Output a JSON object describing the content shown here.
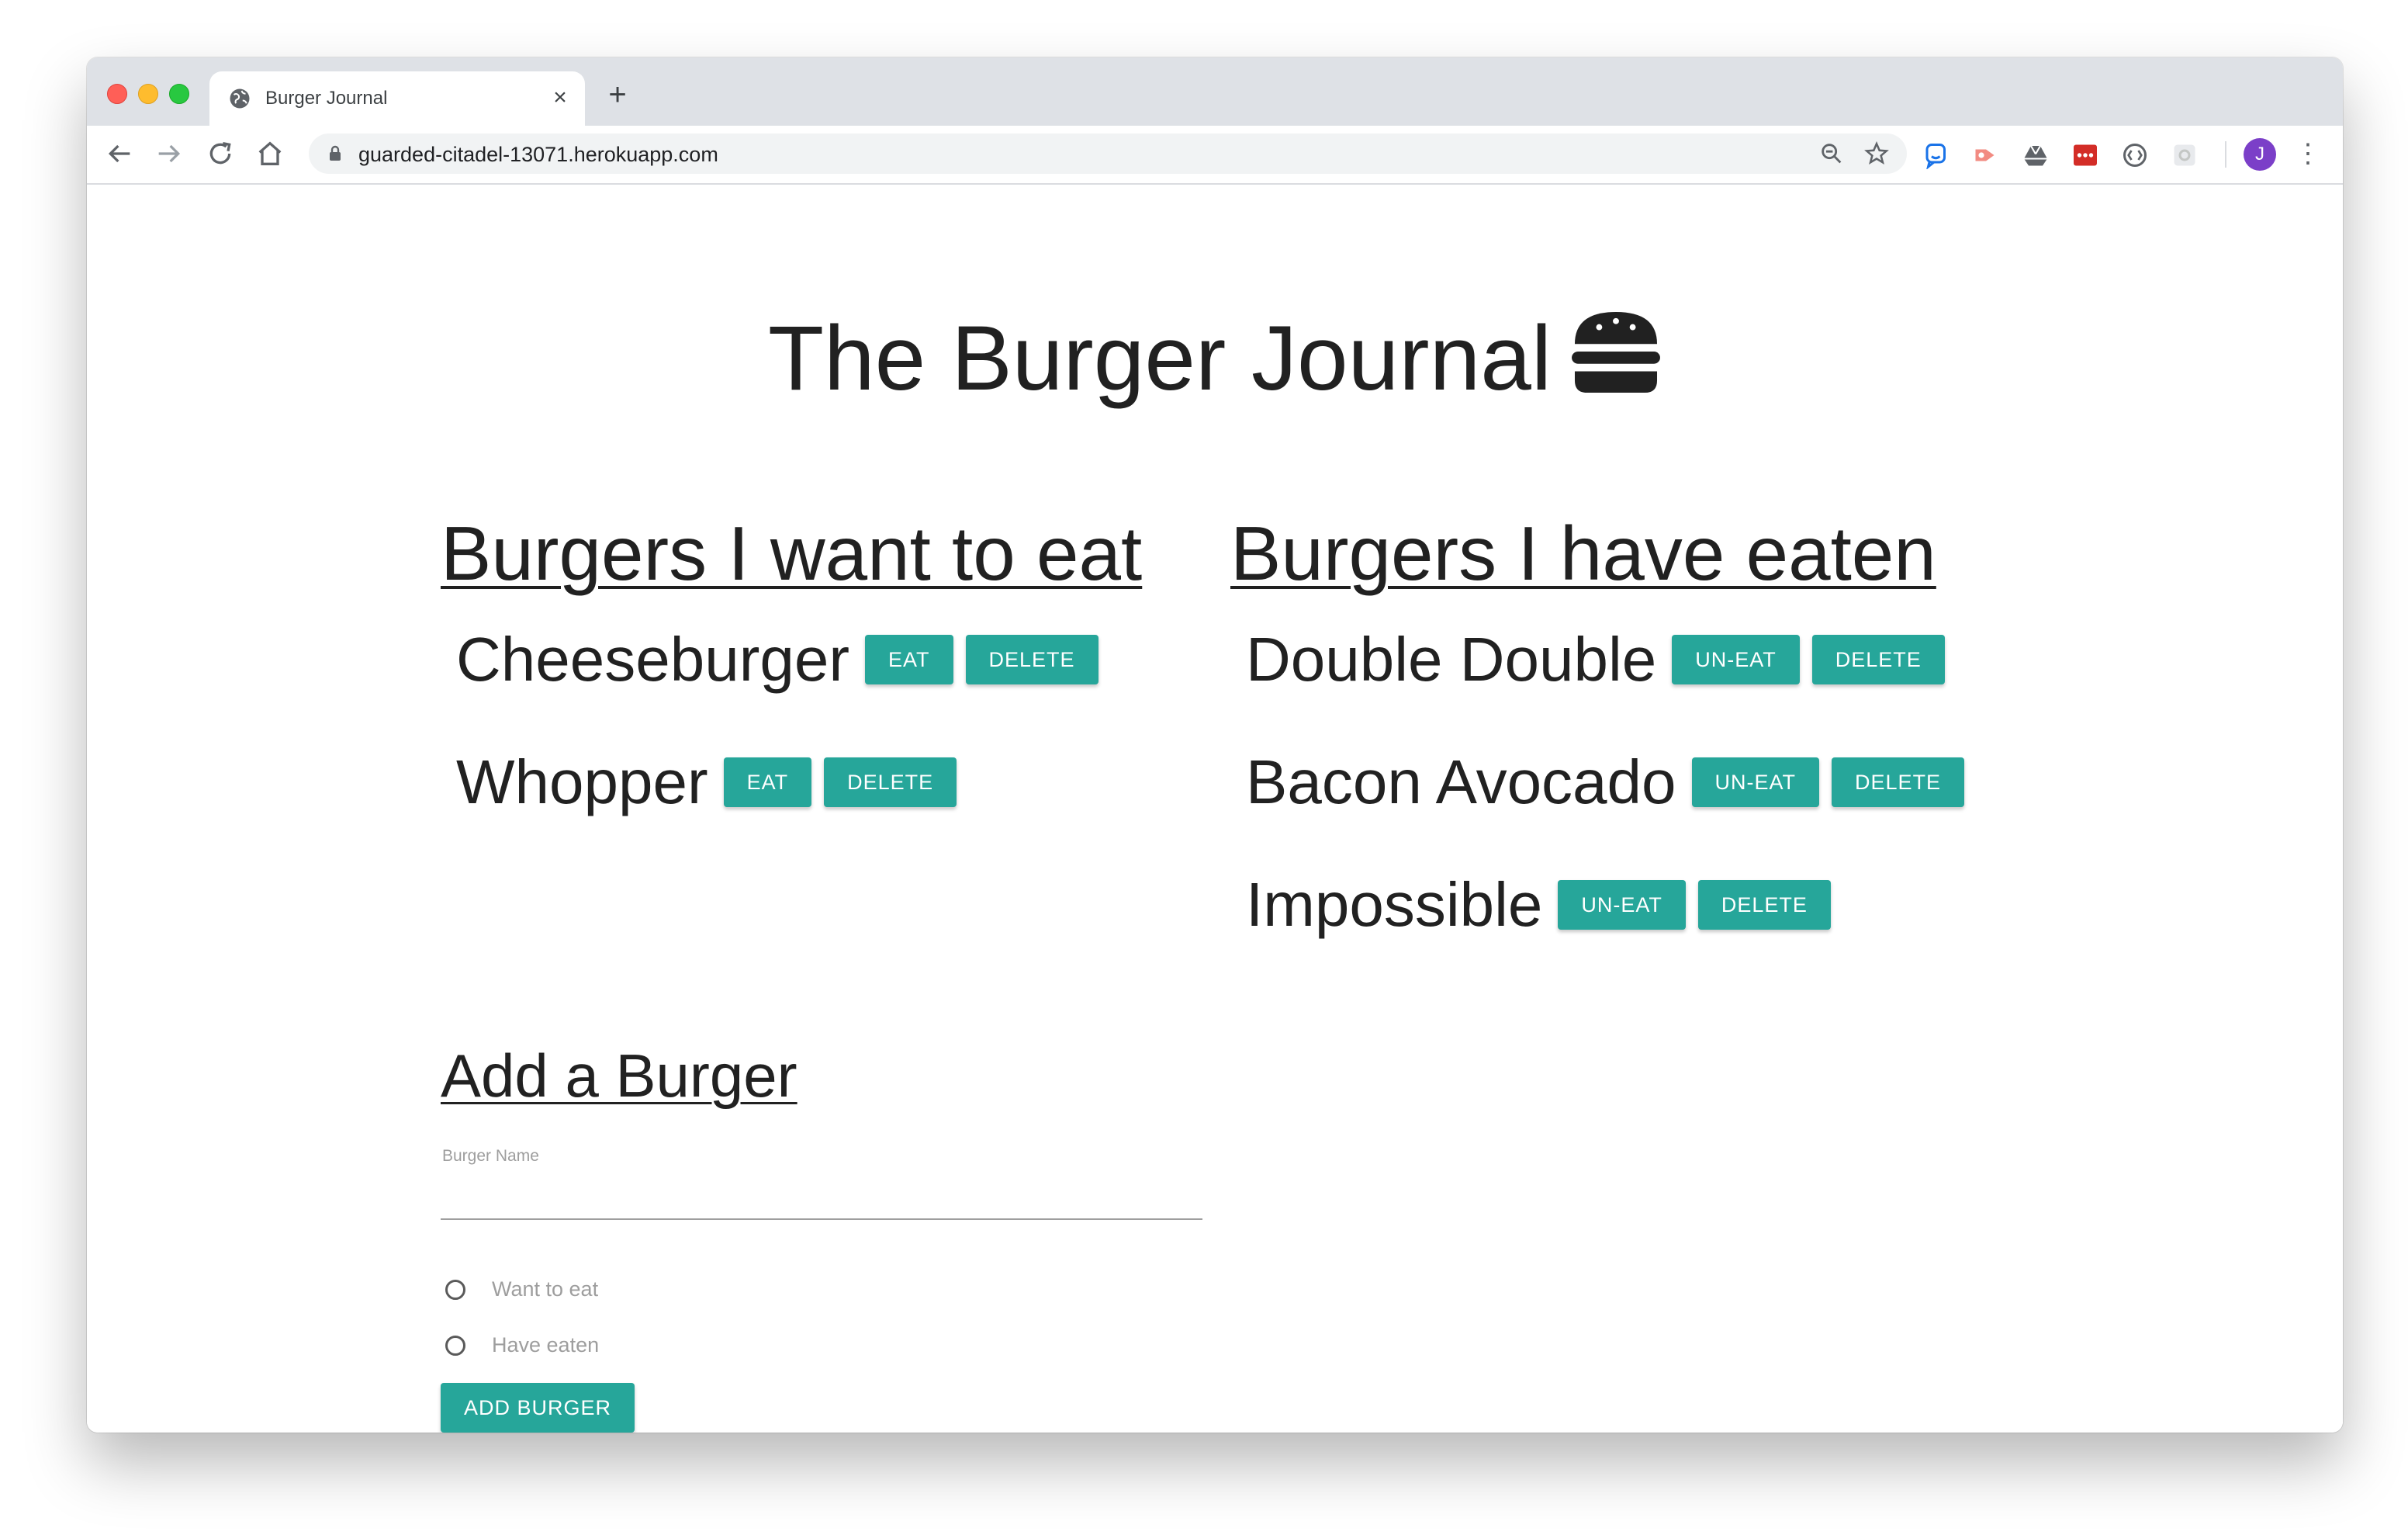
{
  "browser": {
    "tab_title": "Burger Journal",
    "url": "guarded-citadel-13071.herokuapp.com",
    "profile_initial": "J"
  },
  "page": {
    "title": "The Burger Journal",
    "want_heading": "Burgers I want to eat",
    "eaten_heading": "Burgers I have eaten",
    "want_list": [
      {
        "name": "Cheeseburger",
        "action": "EAT",
        "delete": "DELETE"
      },
      {
        "name": "Whopper",
        "action": "EAT",
        "delete": "DELETE"
      }
    ],
    "eaten_list": [
      {
        "name": "Double Double",
        "action": "UN-EAT",
        "delete": "DELETE"
      },
      {
        "name": "Bacon Avocado",
        "action": "UN-EAT",
        "delete": "DELETE"
      },
      {
        "name": "Impossible",
        "action": "UN-EAT",
        "delete": "DELETE"
      }
    ],
    "form": {
      "heading": "Add a Burger",
      "field_label": "Burger Name",
      "field_value": "",
      "radio_want": "Want to eat",
      "radio_eaten": "Have eaten",
      "submit_label": "ADD BURGER"
    }
  },
  "colors": {
    "accent": "#26a69a",
    "text": "#212121",
    "muted": "#9e9e9e"
  },
  "icons": {
    "title_icon": "hamburger-icon"
  }
}
